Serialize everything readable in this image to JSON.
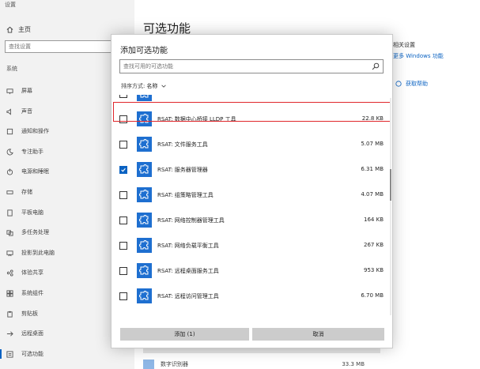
{
  "app": {
    "title": "设置"
  },
  "sidebar": {
    "home": "主页",
    "search_placeholder": "查找设置",
    "section": "系统",
    "items": [
      {
        "label": "屏幕",
        "icon": "monitor-icon"
      },
      {
        "label": "声音",
        "icon": "speaker-icon"
      },
      {
        "label": "通知和操作",
        "icon": "notification-icon"
      },
      {
        "label": "专注助手",
        "icon": "moon-icon"
      },
      {
        "label": "电源和睡眠",
        "icon": "power-icon"
      },
      {
        "label": "存储",
        "icon": "storage-icon"
      },
      {
        "label": "平板电脑",
        "icon": "tablet-icon"
      },
      {
        "label": "多任务处理",
        "icon": "multitask-icon"
      },
      {
        "label": "投影到此电脑",
        "icon": "projector-icon"
      },
      {
        "label": "体验共享",
        "icon": "share-icon"
      },
      {
        "label": "系统组件",
        "icon": "components-icon"
      },
      {
        "label": "剪贴板",
        "icon": "clipboard-icon"
      },
      {
        "label": "远程桌面",
        "icon": "remote-icon"
      },
      {
        "label": "可选功能",
        "icon": "features-icon"
      }
    ],
    "active_index": 13
  },
  "main": {
    "title": "可选功能",
    "related_title": "相关设置",
    "related_link": "更多 Windows 功能",
    "help_link": "获取帮助",
    "bg_feature_name": "数字识别器",
    "bg_feature_size": "33.3 MB"
  },
  "dialog": {
    "title": "添加可选功能",
    "search_placeholder": "查找可用的可选功能",
    "sort_label": "排序方式:",
    "sort_value": "名称",
    "features": [
      {
        "name": "",
        "size": "",
        "checked": false
      },
      {
        "name": "RSAT: 数据中心桥接 LLDP 工具",
        "size": "22.8 KB",
        "checked": false
      },
      {
        "name": "RSAT: 文件服务工具",
        "size": "5.07 MB",
        "checked": false
      },
      {
        "name": "RSAT: 服务器管理器",
        "size": "6.31 MB",
        "checked": true
      },
      {
        "name": "RSAT: 组策略管理工具",
        "size": "4.07 MB",
        "checked": false
      },
      {
        "name": "RSAT: 网络控制器管理工具",
        "size": "164 KB",
        "checked": false
      },
      {
        "name": "RSAT: 网络负载平衡工具",
        "size": "267 KB",
        "checked": false
      },
      {
        "name": "RSAT: 远程桌面服务工具",
        "size": "953 KB",
        "checked": false
      },
      {
        "name": "RSAT: 远程访问管理工具",
        "size": "6.70 MB",
        "checked": false
      }
    ],
    "add_button": "添加 (1)",
    "cancel_button": "取消"
  },
  "colors": {
    "accent": "#0a62c2",
    "highlight": "#e0272c",
    "feature_icon": "#1e6fd0"
  }
}
